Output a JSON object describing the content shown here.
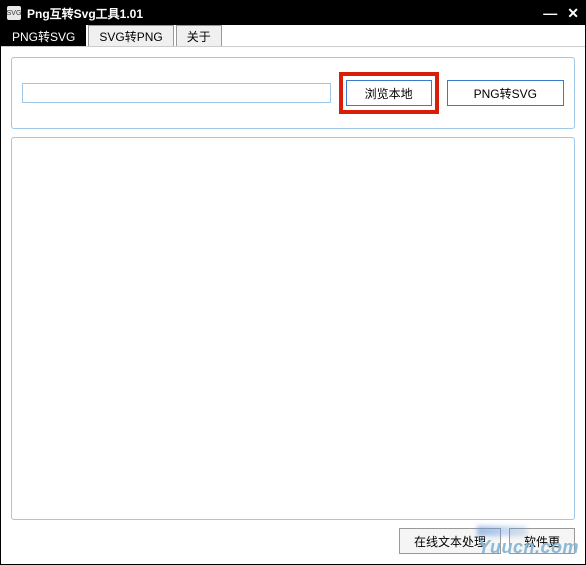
{
  "titlebar": {
    "icon_label": "SVG",
    "title": "Png互转Svg工具1.01"
  },
  "tabs": [
    {
      "label": "PNG转SVG",
      "active": true
    },
    {
      "label": "SVG转PNG",
      "active": false
    },
    {
      "label": "关于",
      "active": false
    }
  ],
  "toolbar": {
    "path_value": "",
    "browse_label": "浏览本地",
    "convert_label": "PNG转SVG"
  },
  "bottom": {
    "online_text_label": "在线文本处理",
    "update_label": "软件更"
  },
  "watermark": "Yuucn.com"
}
